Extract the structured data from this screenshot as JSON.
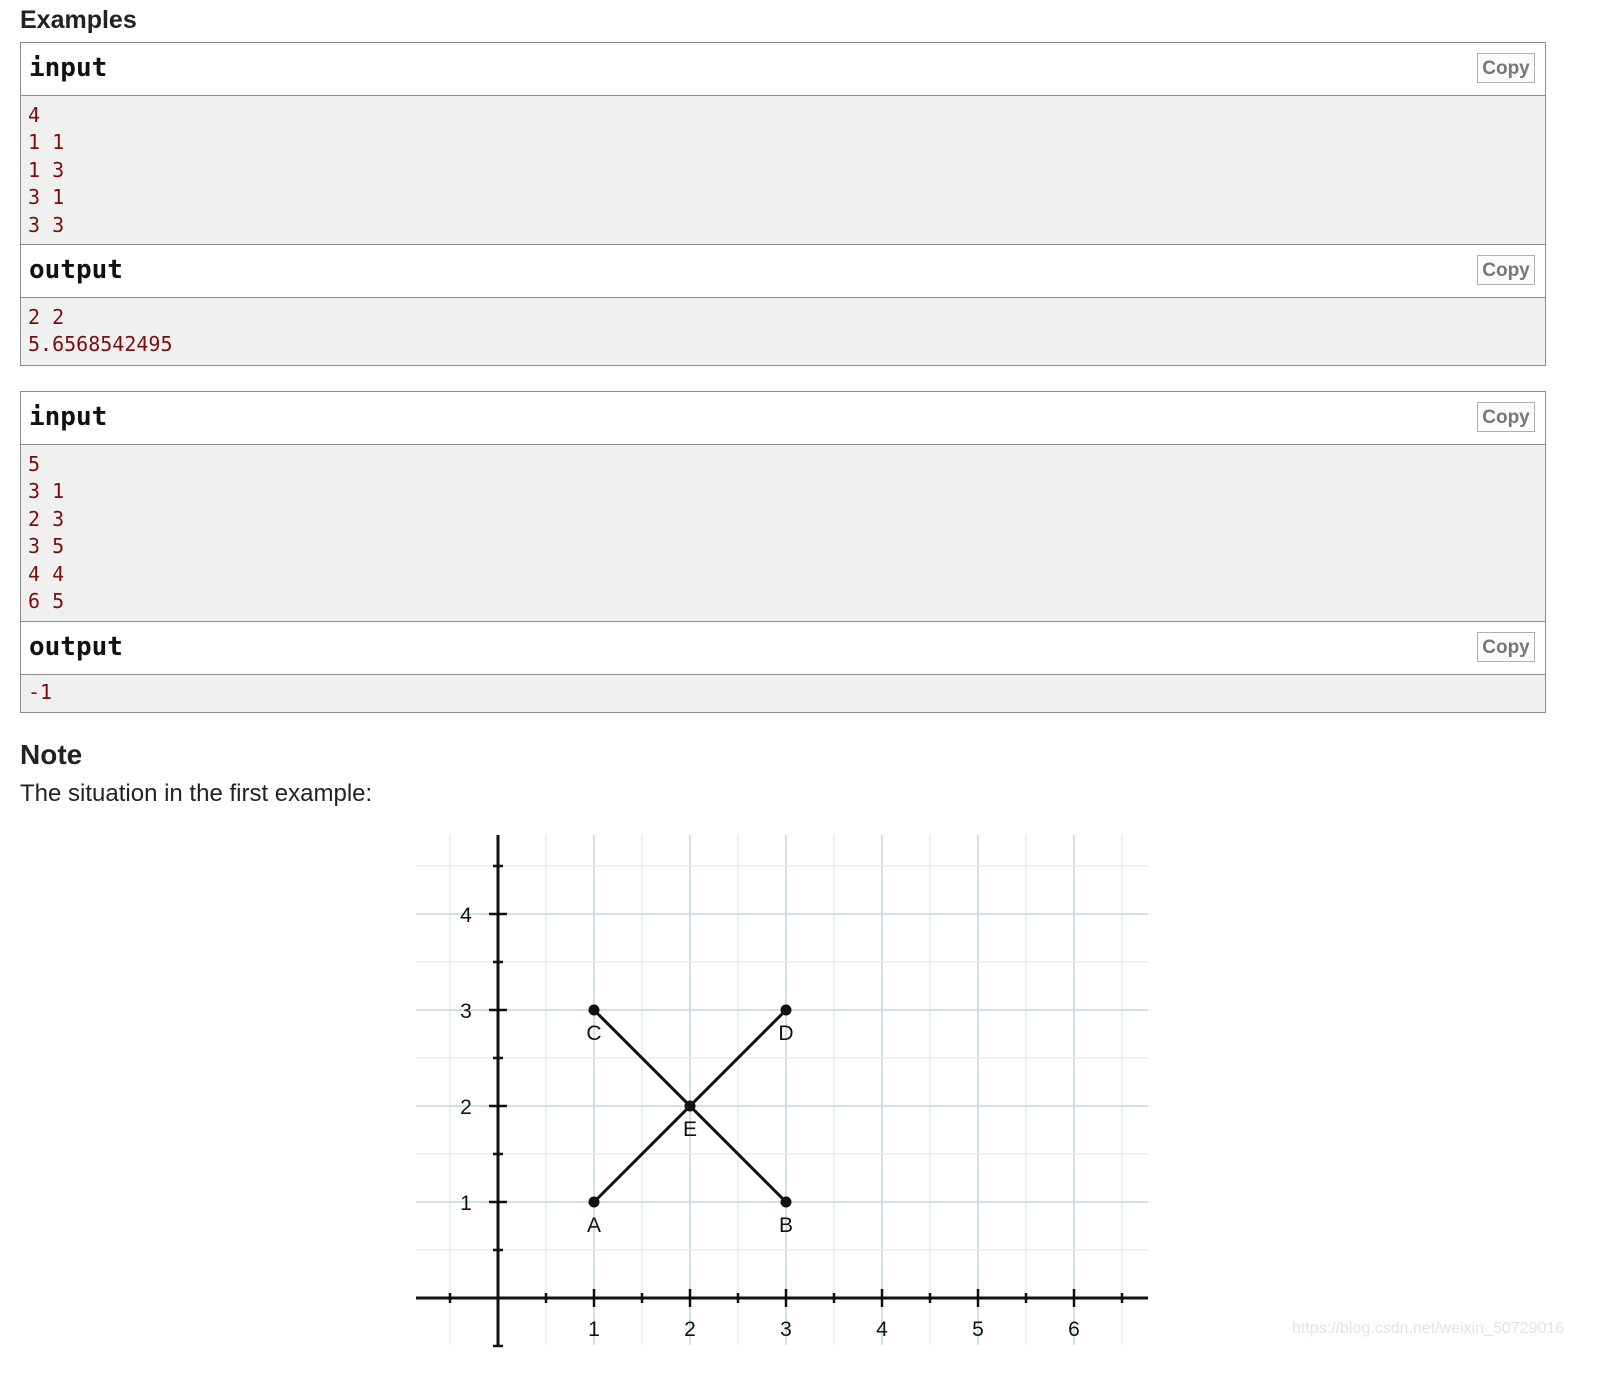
{
  "examples": {
    "title": "Examples",
    "copy_label": "Copy",
    "items": [
      {
        "input_label": "input",
        "input_lines": [
          "4",
          "1 1",
          "1 3",
          "3 1",
          "3 3"
        ],
        "output_label": "output",
        "output_lines": [
          "2 2",
          "5.6568542495"
        ]
      },
      {
        "input_label": "input",
        "input_lines": [
          "5",
          "3 1",
          "2 3",
          "3 5",
          "4 4",
          "6 5"
        ],
        "output_label": "output",
        "output_lines": [
          "-1"
        ]
      }
    ]
  },
  "note": {
    "title": "Note",
    "text": "The situation in the first example:"
  },
  "chart_data": {
    "type": "scatter",
    "title": "",
    "xlabel": "",
    "ylabel": "",
    "xlim": [
      -0.85,
      6.8
    ],
    "ylim": [
      -0.5,
      4.7
    ],
    "x_ticks": [
      "1",
      "2",
      "3",
      "4",
      "5",
      "6"
    ],
    "y_ticks": [
      "1",
      "2",
      "3",
      "4"
    ],
    "grid": true,
    "points": [
      {
        "label": "A",
        "x": 1,
        "y": 1
      },
      {
        "label": "B",
        "x": 3,
        "y": 1
      },
      {
        "label": "C",
        "x": 1,
        "y": 3
      },
      {
        "label": "D",
        "x": 3,
        "y": 3
      },
      {
        "label": "E",
        "x": 2,
        "y": 2
      }
    ],
    "segments": [
      {
        "from": "A",
        "to": "D"
      },
      {
        "from": "C",
        "to": "B"
      }
    ]
  },
  "watermark": "https://blog.csdn.net/weixin_50729016"
}
